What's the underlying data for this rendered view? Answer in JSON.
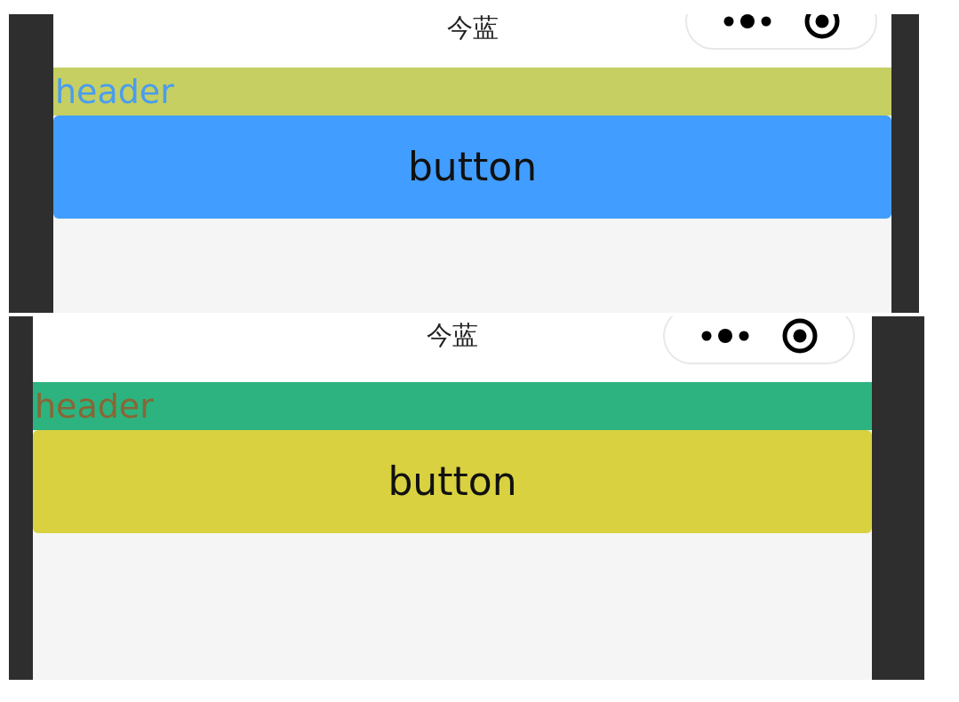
{
  "screens": [
    {
      "title": "今蓝",
      "header": {
        "color": "#c5cf62",
        "label": {
          "text": "header",
          "color": "#4a9cf0"
        }
      },
      "button": {
        "label": "button",
        "color": "#419dff"
      }
    },
    {
      "title": "今蓝",
      "header": {
        "color": "#2db37f",
        "label": {
          "text": "header",
          "color": "#8a6535"
        }
      },
      "button": {
        "label": "button",
        "color": "#d9d140"
      }
    }
  ]
}
